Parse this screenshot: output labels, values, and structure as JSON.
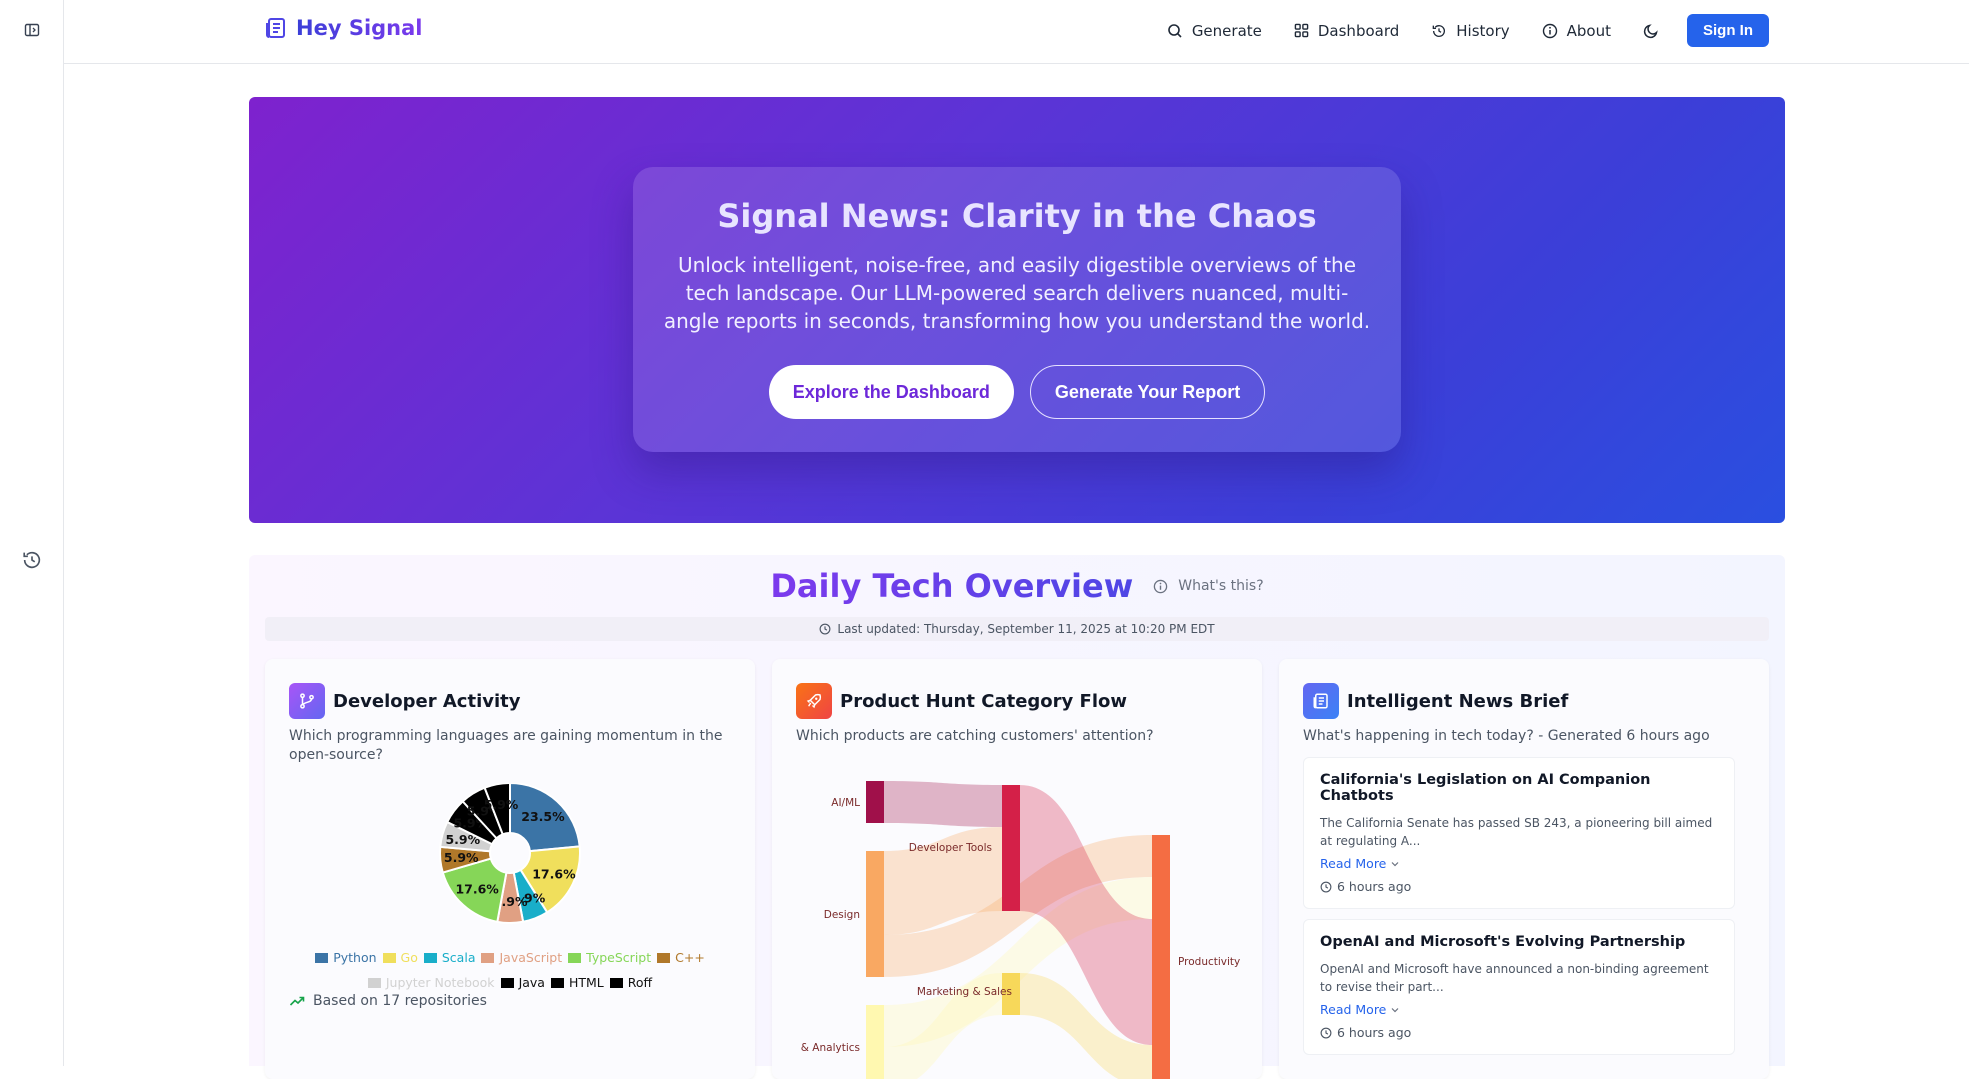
{
  "brand": {
    "name": "Hey Signal"
  },
  "nav": {
    "generate": "Generate",
    "dashboard": "Dashboard",
    "history": "History",
    "about": "About",
    "sign_in": "Sign In"
  },
  "hero": {
    "title": "Signal News: Clarity in the Chaos",
    "subtitle": "Unlock intelligent, noise-free, and easily digestible overviews of the tech landscape. Our LLM-powered search delivers nuanced, multi-angle reports in seconds, transforming how you understand the world.",
    "primary_button": "Explore the Dashboard",
    "secondary_button": "Generate Your Report"
  },
  "overview": {
    "title": "Daily Tech Overview",
    "whats_this": "What's this?",
    "last_updated": "Last updated: Thursday, September 11, 2025 at 10:20 PM EDT"
  },
  "developer_activity": {
    "title": "Developer Activity",
    "subtitle": "Which programming languages are gaining momentum in the open-source?",
    "based_on": "Based on 17 repositories",
    "colors": {
      "Python": "#3b74a6",
      "Go": "#f0df5c",
      "Scala": "#19aec9",
      "JavaScript": "#e0a083",
      "TypeScript": "#86d658",
      "C++": "#b0782a",
      "Jupyter Notebook": "#d1d1d1",
      "Java": "#000000",
      "HTML": "#000000",
      "Roff": "#000000"
    }
  },
  "product_hunt": {
    "title": "Product Hunt Category Flow",
    "subtitle": "Which products are catching customers' attention?"
  },
  "news": {
    "title": "Intelligent News Brief",
    "subtitle": "What's happening in tech today? - Generated 6 hours ago",
    "items": [
      {
        "title": "California's Legislation on AI Companion Chatbots",
        "body": "The California Senate has passed SB 243, a pioneering bill aimed at regulating A...",
        "read_more": "Read More",
        "time": "6 hours ago"
      },
      {
        "title": "OpenAI and Microsoft's Evolving Partnership",
        "body": "OpenAI and Microsoft have announced a non-binding agreement to revise their part...",
        "read_more": "Read More",
        "time": "6 hours ago"
      }
    ]
  },
  "chart_data": [
    {
      "type": "pie",
      "title": "",
      "categories": [
        "Python",
        "Go",
        "Scala",
        "JavaScript",
        "TypeScript",
        "C++",
        "Jupyter Notebook",
        "Java",
        "HTML",
        "Roff"
      ],
      "values": [
        23.5,
        17.6,
        5.9,
        5.9,
        17.6,
        5.9,
        5.9,
        5.9,
        5.9,
        5.9
      ],
      "data_labels": [
        "23.5%",
        "17.6%",
        "5.9%",
        "5.9%",
        "17.6%",
        "5.9%",
        "5.9%",
        "5.9%",
        "5.9%",
        "5.9%"
      ],
      "legend_placement": "bottom"
    },
    {
      "type": "sankey",
      "title": "",
      "nodes": [
        "AI/ML",
        "Design",
        "& Analytics",
        "Developer Tools",
        "Marketing & Sales",
        "Productivity"
      ],
      "links": [
        {
          "source": "AI/ML",
          "target": "Developer Tools",
          "value": 1
        },
        {
          "source": "Design",
          "target": "Developer Tools",
          "value": 2
        },
        {
          "source": "Design",
          "target": "Productivity",
          "value": 1
        },
        {
          "source": "& Analytics",
          "target": "Productivity",
          "value": 1
        },
        {
          "source": "& Analytics",
          "target": "Marketing & Sales",
          "value": 1
        },
        {
          "source": "Developer Tools",
          "target": "Productivity",
          "value": 3
        },
        {
          "source": "Marketing & Sales",
          "target": "Productivity",
          "value": 1
        }
      ],
      "node_colors": {
        "AI/ML": "#a0104a",
        "Design": "#f9a862",
        "& Analytics": "#fff8b0",
        "Developer Tools": "#d42048",
        "Marketing & Sales": "#f7d85a",
        "Productivity": "#f46d43"
      }
    }
  ]
}
